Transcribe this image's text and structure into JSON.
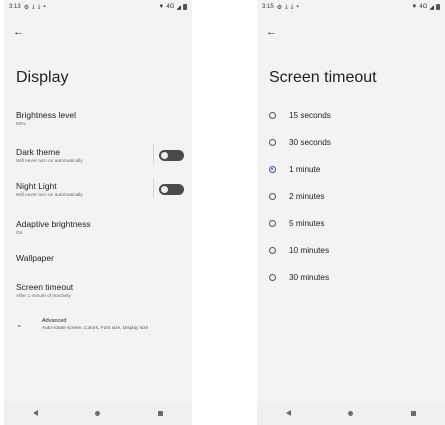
{
  "left_screen": {
    "status": {
      "time": "3:13",
      "network": "4G"
    },
    "title": "Display",
    "items": [
      {
        "label": "Brightness level",
        "sub": "83%"
      },
      {
        "label": "Dark theme",
        "sub": "Will never turn on automatically",
        "toggle": false
      },
      {
        "label": "Night Light",
        "sub": "Will never turn on automatically",
        "toggle": false
      },
      {
        "label": "Adaptive brightness",
        "sub": "On"
      },
      {
        "label": "Wallpaper",
        "sub": ""
      },
      {
        "label": "Screen timeout",
        "sub": "After 1 minute of inactivity"
      }
    ],
    "advanced": {
      "label": "Advanced",
      "sub": "Auto-rotate screen, Colors, Font size, Display size"
    }
  },
  "right_screen": {
    "status": {
      "time": "3:15",
      "network": "4G"
    },
    "title": "Screen timeout",
    "options": [
      "15 seconds",
      "30 seconds",
      "1 minute",
      "2 minutes",
      "5 minutes",
      "10 minutes",
      "30 minutes"
    ],
    "selected": "1 minute"
  },
  "icons": {
    "back": "back-arrow-icon",
    "chevron": "chevron-down-icon"
  }
}
